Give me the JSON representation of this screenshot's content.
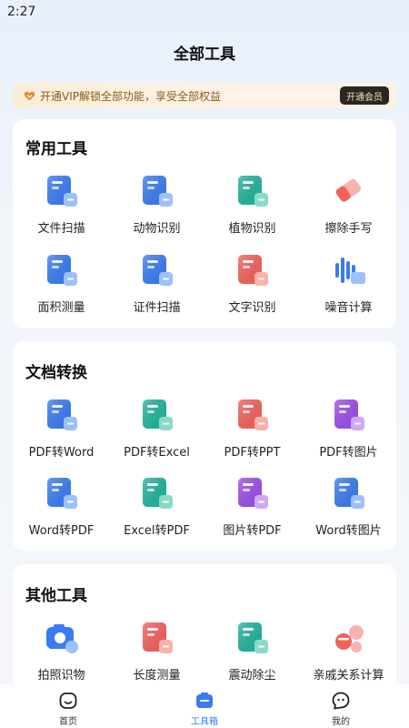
{
  "status": {
    "time": "2:27"
  },
  "header": {
    "title": "全部工具"
  },
  "vip": {
    "text": "开通VIP解锁全部功能，享受全部权益",
    "button": "开通会员"
  },
  "sections": [
    {
      "title": "常用工具",
      "tools": [
        {
          "label": "文件扫描",
          "icon": "file-scan-icon",
          "color": "#3a7bf0"
        },
        {
          "label": "动物识别",
          "icon": "animal-recognition-icon",
          "color": "#3a7bf0"
        },
        {
          "label": "植物识别",
          "icon": "plant-recognition-icon",
          "color": "#22b39a"
        },
        {
          "label": "擦除手写",
          "icon": "eraser-icon",
          "color": "#f0625a"
        },
        {
          "label": "面积测量",
          "icon": "area-measure-icon",
          "color": "#3a7bf0"
        },
        {
          "label": "证件扫描",
          "icon": "id-scan-icon",
          "color": "#3a7bf0"
        },
        {
          "label": "文字识别",
          "icon": "text-recognition-icon",
          "color": "#f0625a"
        },
        {
          "label": "噪音计算",
          "icon": "noise-meter-icon",
          "color": "#3a7bf0"
        }
      ]
    },
    {
      "title": "文档转换",
      "tools": [
        {
          "label": "PDF转Word",
          "icon": "pdf-to-word-icon",
          "color": "#3a7bf0"
        },
        {
          "label": "PDF转Excel",
          "icon": "pdf-to-excel-icon",
          "color": "#22b39a"
        },
        {
          "label": "PDF转PPT",
          "icon": "pdf-to-ppt-icon",
          "color": "#f0625a"
        },
        {
          "label": "PDF转图片",
          "icon": "pdf-to-image-icon",
          "color": "#9b4ee8"
        },
        {
          "label": "Word转PDF",
          "icon": "word-to-pdf-icon",
          "color": "#3a7bf0"
        },
        {
          "label": "Excel转PDF",
          "icon": "excel-to-pdf-icon",
          "color": "#22b39a"
        },
        {
          "label": "图片转PDF",
          "icon": "image-to-pdf-icon",
          "color": "#9b4ee8"
        },
        {
          "label": "Word转图片",
          "icon": "word-to-image-icon",
          "color": "#3a7bf0"
        }
      ]
    },
    {
      "title": "其他工具",
      "tools": [
        {
          "label": "拍照识物",
          "icon": "photo-recognition-icon",
          "color": "#3a7bf0"
        },
        {
          "label": "长度测量",
          "icon": "length-measure-icon",
          "color": "#f0625a"
        },
        {
          "label": "震动除尘",
          "icon": "vibration-dust-icon",
          "color": "#22b39a"
        },
        {
          "label": "亲戚关系计算",
          "icon": "relative-calculator-icon",
          "color": "#f0625a"
        }
      ]
    }
  ],
  "tabbar": [
    {
      "label": "首页",
      "icon": "home-icon",
      "active": false
    },
    {
      "label": "工具箱",
      "icon": "toolbox-icon",
      "active": true
    },
    {
      "label": "我的",
      "icon": "profile-icon",
      "active": false
    }
  ],
  "colors": {
    "accent": "#3a7bf0",
    "text": "#1b1b1f",
    "vip_text": "#8a5a1f"
  }
}
